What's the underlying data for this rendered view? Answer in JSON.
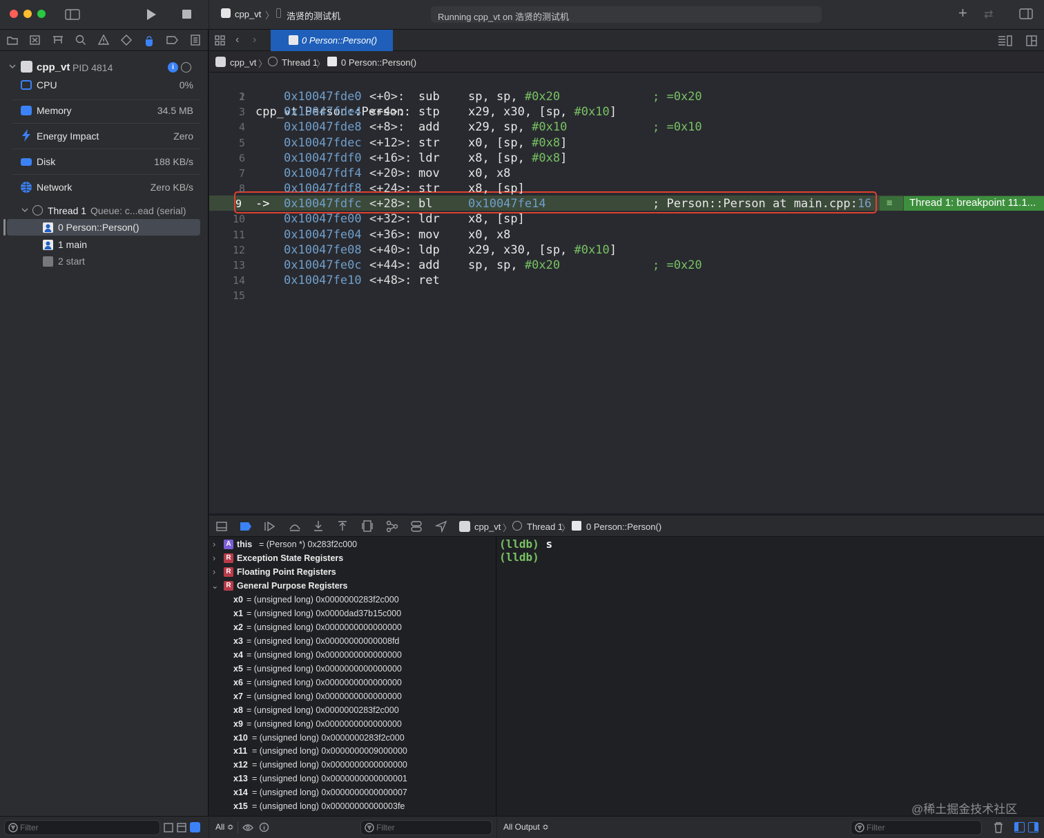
{
  "window": {
    "scheme": "cpp_vt",
    "destination": "浩贤的测试机",
    "status": "Running cpp_vt on 浩贤的测试机"
  },
  "tab": {
    "label": "0 Person::Person()"
  },
  "jumpbar": {
    "project": "cpp_vt",
    "thread": "Thread 1",
    "frame": "0 Person::Person()"
  },
  "sidebar": {
    "process_name": "cpp_vt",
    "pid": "PID 4814",
    "gauges": [
      {
        "label": "CPU",
        "value": "0%",
        "icon": "cpu-icon",
        "color": "#3b7ddd"
      },
      {
        "label": "Memory",
        "value": "34.5 MB",
        "icon": "memory-icon",
        "color": "#3b7ddd"
      },
      {
        "label": "Energy Impact",
        "value": "Zero",
        "icon": "bolt-icon",
        "color": "#3b7ddd"
      },
      {
        "label": "Disk",
        "value": "188 KB/s",
        "icon": "disk-icon",
        "color": "#3b7ddd"
      },
      {
        "label": "Network",
        "value": "Zero KB/s",
        "icon": "globe-icon",
        "color": "#3b7ddd"
      }
    ],
    "thread_name": "Thread 1",
    "thread_queue": "Queue: c...ead (serial)",
    "frames": [
      {
        "label": "0 Person::Person()",
        "selected": true
      },
      {
        "label": "1 main",
        "selected": false
      },
      {
        "label": "2 start",
        "selected": false
      }
    ],
    "filter_placeholder": "Filter"
  },
  "editor": {
    "header": "cpp_vt`Person::Person:",
    "lines": [
      {
        "n": "1",
        "text": ""
      },
      {
        "n": "2",
        "addr": "0x10047fde0",
        "off": "<+0>:",
        "op": "sub",
        "args": "sp, sp, ",
        "imm": "#0x20",
        "cmt": "; =0x20"
      },
      {
        "n": "3",
        "addr": "0x10047fde4",
        "off": "<+4>:",
        "op": "stp",
        "args": "x29, x30, [sp, ",
        "imm": "#0x10",
        "tail": "]",
        "cmt": ""
      },
      {
        "n": "4",
        "addr": "0x10047fde8",
        "off": "<+8>:",
        "op": "add",
        "args": "x29, sp, ",
        "imm": "#0x10",
        "cmt": "; =0x10"
      },
      {
        "n": "5",
        "addr": "0x10047fdec",
        "off": "<+12>:",
        "op": "str",
        "args": "x0, [sp, ",
        "imm": "#0x8",
        "tail": "]",
        "cmt": ""
      },
      {
        "n": "6",
        "addr": "0x10047fdf0",
        "off": "<+16>:",
        "op": "ldr",
        "args": "x8, [sp, ",
        "imm": "#0x8",
        "tail": "]",
        "cmt": ""
      },
      {
        "n": "7",
        "addr": "0x10047fdf4",
        "off": "<+20>:",
        "op": "mov",
        "args": "x0, x8",
        "cmt": ""
      },
      {
        "n": "8",
        "addr": "0x10047fdf8",
        "off": "<+24>:",
        "op": "str",
        "args": "x8, [sp]",
        "cmt": ""
      },
      {
        "n": "9",
        "arrow": "->",
        "addr": "0x10047fdfc",
        "off": "<+28>:",
        "op": "bl",
        "args": "",
        "target": "0x10047fe14",
        "cmt": "; Person::Person at main.cpp:",
        "cmtnum": "16",
        "current": true
      },
      {
        "n": "10",
        "addr": "0x10047fe00",
        "off": "<+32>:",
        "op": "ldr",
        "args": "x8, [sp]",
        "cmt": ""
      },
      {
        "n": "11",
        "addr": "0x10047fe04",
        "off": "<+36>:",
        "op": "mov",
        "args": "x0, x8",
        "cmt": ""
      },
      {
        "n": "12",
        "addr": "0x10047fe08",
        "off": "<+40>:",
        "op": "ldp",
        "args": "x29, x30, [sp, ",
        "imm": "#0x10",
        "tail": "]",
        "cmt": ""
      },
      {
        "n": "13",
        "addr": "0x10047fe0c",
        "off": "<+44>:",
        "op": "add",
        "args": "sp, sp, ",
        "imm": "#0x20",
        "cmt": "; =0x20"
      },
      {
        "n": "14",
        "addr": "0x10047fe10",
        "off": "<+48>:",
        "op": "ret",
        "args": "",
        "cmt": ""
      },
      {
        "n": "15",
        "text": ""
      }
    ],
    "breakpoint_label": "Thread 1: breakpoint 11.1..."
  },
  "debugbar": {
    "project": "cpp_vt",
    "thread": "Thread 1",
    "frame": "0 Person::Person()"
  },
  "variables": {
    "this_row": {
      "badge": "A",
      "name": "this",
      "value": "= (Person *) 0x283f2c000"
    },
    "groups": [
      "Exception State Registers",
      "Floating Point Registers",
      "General Purpose Registers"
    ],
    "registers": [
      {
        "name": "x0",
        "value": "= (unsigned long) 0x0000000283f2c000"
      },
      {
        "name": "x1",
        "value": "= (unsigned long) 0x0000dad37b15c000"
      },
      {
        "name": "x2",
        "value": "= (unsigned long) 0x0000000000000000"
      },
      {
        "name": "x3",
        "value": "= (unsigned long) 0x00000000000008fd"
      },
      {
        "name": "x4",
        "value": "= (unsigned long) 0x0000000000000000"
      },
      {
        "name": "x5",
        "value": "= (unsigned long) 0x0000000000000000"
      },
      {
        "name": "x6",
        "value": "= (unsigned long) 0x0000000000000000"
      },
      {
        "name": "x7",
        "value": "= (unsigned long) 0x0000000000000000"
      },
      {
        "name": "x8",
        "value": "= (unsigned long) 0x0000000283f2c000"
      },
      {
        "name": "x9",
        "value": "= (unsigned long) 0x0000000000000000"
      },
      {
        "name": "x10",
        "value": "= (unsigned long) 0x0000000283f2c000"
      },
      {
        "name": "x11",
        "value": "= (unsigned long) 0x0000000009000000"
      },
      {
        "name": "x12",
        "value": "= (unsigned long) 0x0000000000000000"
      },
      {
        "name": "x13",
        "value": "= (unsigned long) 0x0000000000000001"
      },
      {
        "name": "x14",
        "value": "= (unsigned long) 0x0000000000000007"
      },
      {
        "name": "x15",
        "value": "= (unsigned long) 0x00000000000003fe"
      }
    ],
    "scope": "All ≎",
    "filter_placeholder": "Filter"
  },
  "console": {
    "lines": [
      {
        "prompt": "(lldb)",
        "cmd": "s"
      },
      {
        "prompt": "(lldb)",
        "cmd": ""
      }
    ],
    "output_mode": "All Output ≎",
    "filter_placeholder": "Filter"
  },
  "watermark": "@稀土掘金技术社区"
}
